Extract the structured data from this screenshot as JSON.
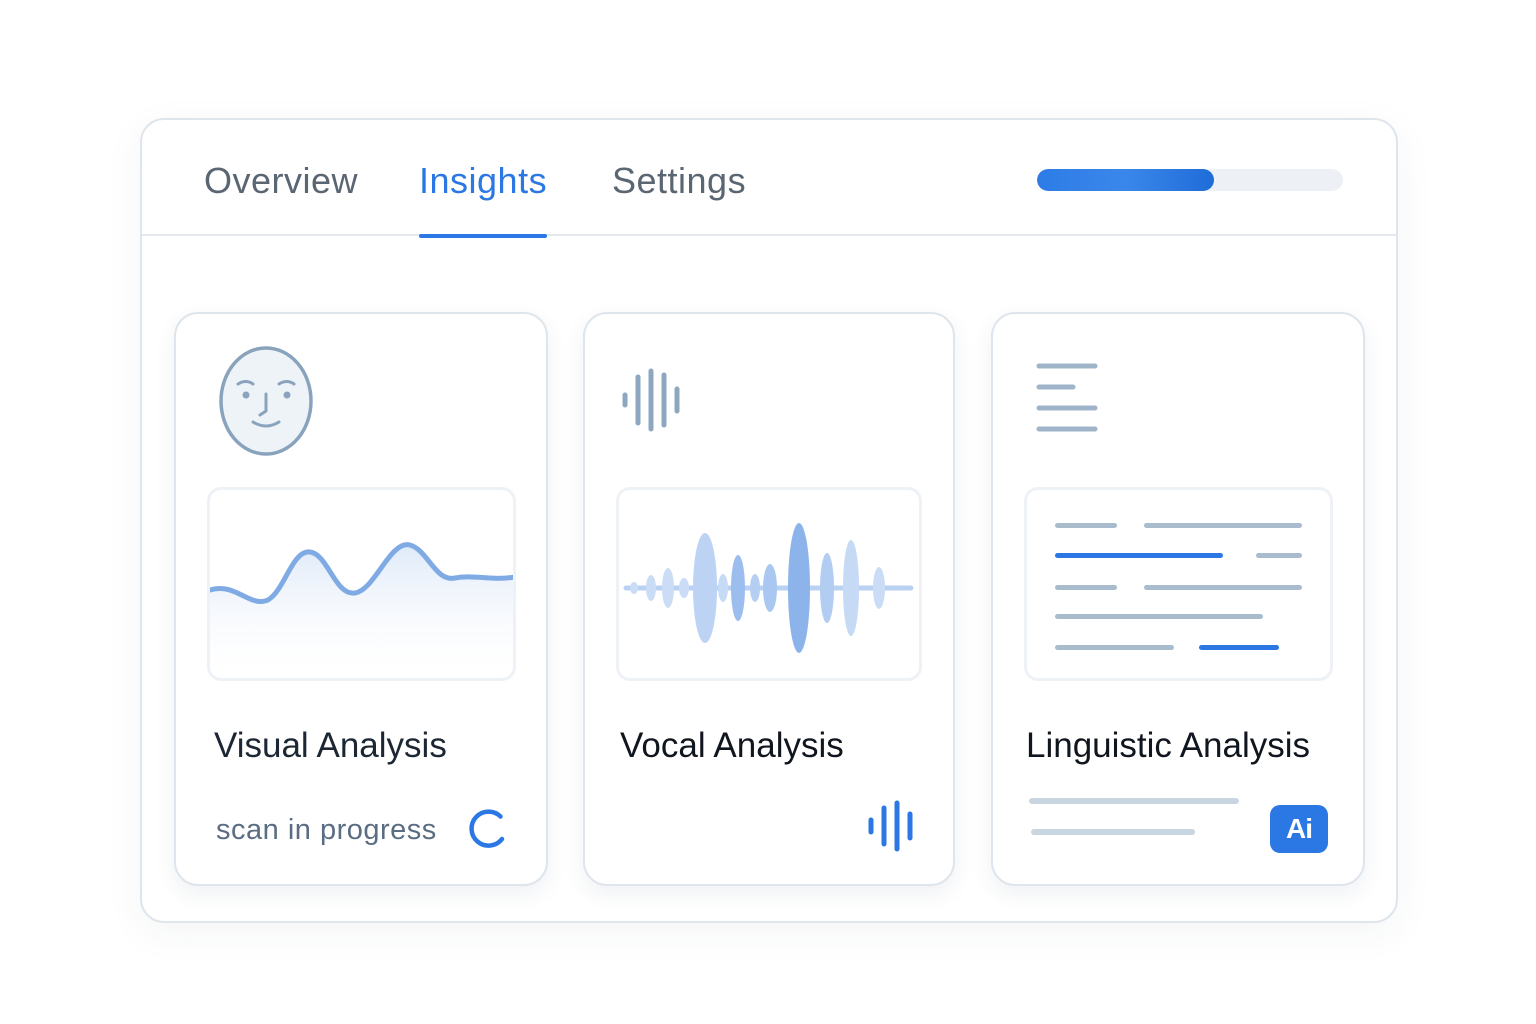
{
  "tabs": [
    {
      "label": "Overview",
      "active": false
    },
    {
      "label": "Insights",
      "active": true
    },
    {
      "label": "Settings",
      "active": false
    }
  ],
  "progress": {
    "value": 0.58
  },
  "cards": [
    {
      "title": "Visual Analysis",
      "status": "scan in progress",
      "icon": "face-icon",
      "status_icon": "spinner-icon"
    },
    {
      "title": "Vocal Analysis",
      "icon": "audio-bars-icon",
      "status_icon": "audio-bars-icon"
    },
    {
      "title": "Linguistic Analysis",
      "icon": "text-lines-icon",
      "badge": "Ai"
    }
  ],
  "colors": {
    "accent": "#2b78e4",
    "muted_icon": "#8ea7c0",
    "border": "#dfe5ec"
  }
}
